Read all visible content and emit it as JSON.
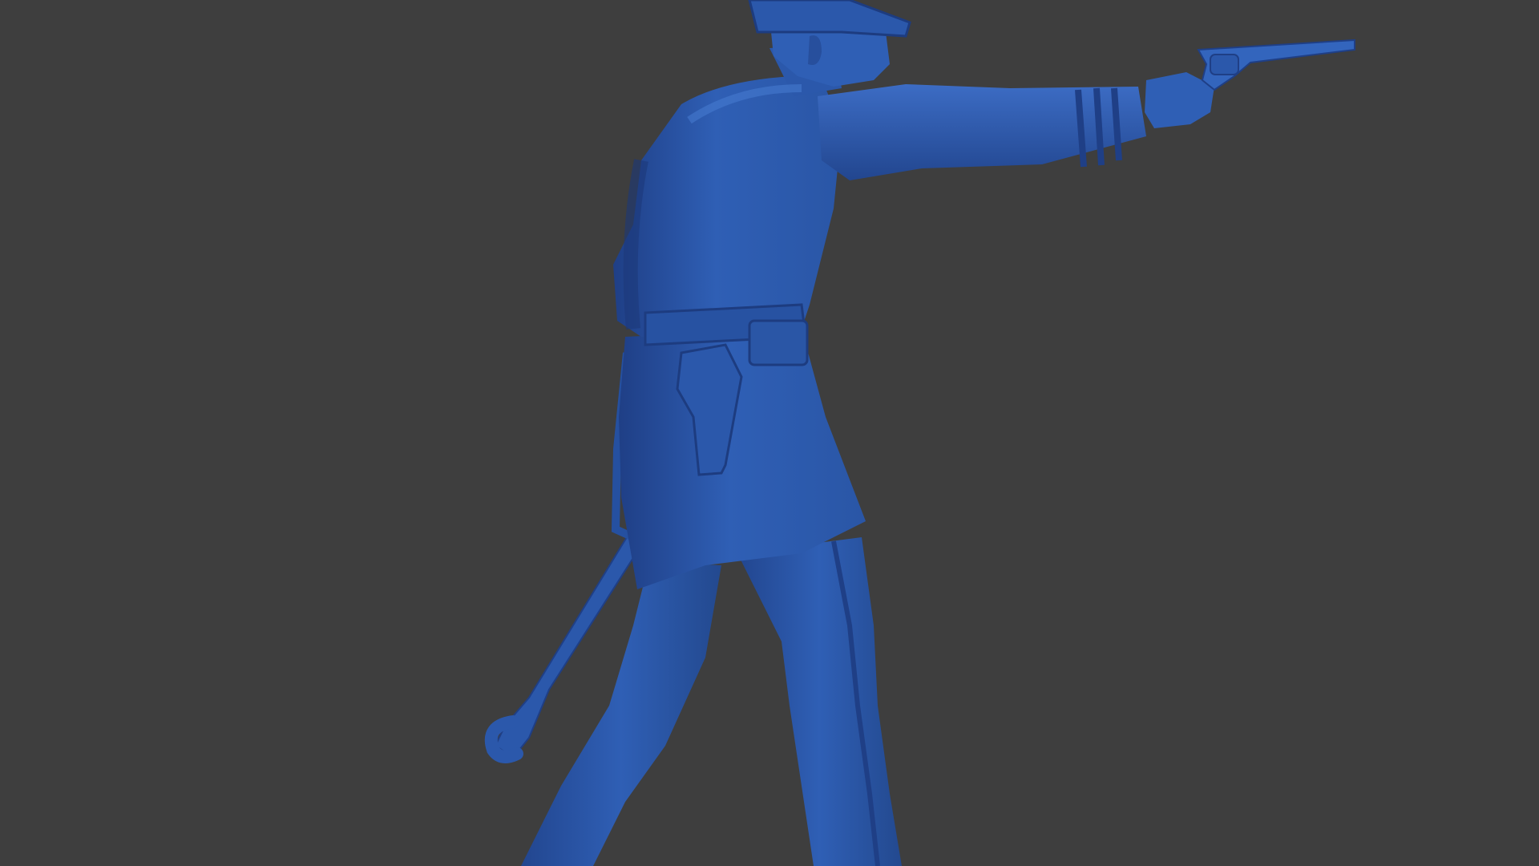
{
  "scene": {
    "background_color": "#3e3e3e",
    "model_color": "#2f5fb5",
    "model_shadow_color": "#1f3f86",
    "model_highlight_color": "#4a7fd6"
  },
  "model": {
    "subject": "soldier-figure-sculpt",
    "view": "three-quarter-back",
    "pose": "aiming-revolver-right-arm-extended"
  }
}
